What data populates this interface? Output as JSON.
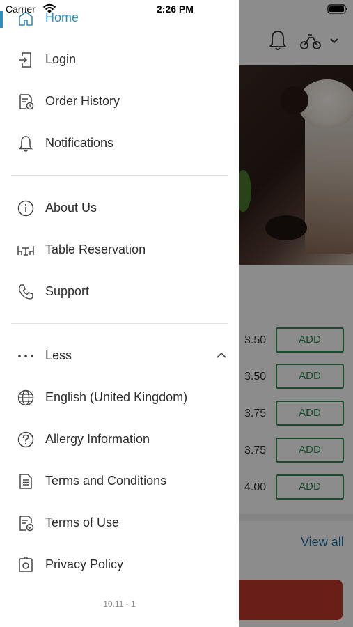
{
  "status_bar": {
    "carrier": "Carrier",
    "time": "2:26 PM"
  },
  "drawer": {
    "items": [
      {
        "label": "Home",
        "icon": "home-icon",
        "active": true
      },
      {
        "label": "Login",
        "icon": "login-icon"
      },
      {
        "label": "Order History",
        "icon": "order-history-icon"
      },
      {
        "label": "Notifications",
        "icon": "bell-icon"
      },
      {
        "label": "About Us",
        "icon": "info-icon"
      },
      {
        "label": "Table Reservation",
        "icon": "table-icon"
      },
      {
        "label": "Support",
        "icon": "phone-icon"
      },
      {
        "label": "Less",
        "icon": "more-dots-icon"
      },
      {
        "label": "English (United Kingdom)",
        "icon": "globe-icon"
      },
      {
        "label": "Allergy Information",
        "icon": "question-icon"
      },
      {
        "label": "Terms and Conditions",
        "icon": "document-icon"
      },
      {
        "label": "Terms of Use",
        "icon": "document-check-icon"
      },
      {
        "label": "Privacy Policy",
        "icon": "privacy-icon"
      }
    ],
    "version": "10.11 - 1"
  },
  "background": {
    "prices": [
      "3.50",
      "3.50",
      "3.75",
      "3.75",
      "4.00"
    ],
    "add_label": "ADD",
    "view_all": "View all"
  },
  "colors": {
    "accent": "#2f8fbf",
    "add_green": "#2e8b57",
    "view_all_blue": "#1a73a8"
  }
}
